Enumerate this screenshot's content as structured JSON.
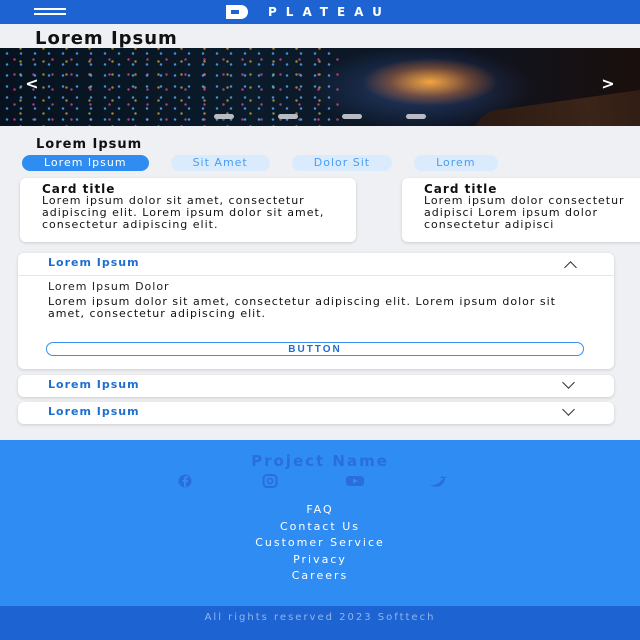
{
  "header": {
    "brand": "PLATEAU",
    "menu_icon": "hamburger-icon",
    "logo_icon": "plateau-logo-icon"
  },
  "page": {
    "title": "Lorem Ipsum"
  },
  "carousel": {
    "prev_label": "<",
    "next_label": ">",
    "slide_count": 4,
    "active_slide": 1
  },
  "section": {
    "title": "Lorem Ipsum"
  },
  "chips": [
    {
      "label": "Lorem Ipsum",
      "active": true
    },
    {
      "label": "Sit Amet",
      "active": false
    },
    {
      "label": "Dolor Sit",
      "active": false
    },
    {
      "label": "Lorem",
      "active": false
    }
  ],
  "cards": [
    {
      "title": "Card title",
      "text": "Lorem ipsum dolor sit amet, consectetur adipiscing elit. Lorem ipsum dolor sit amet, consectetur adipiscing elit."
    },
    {
      "title": "Card title",
      "text": "Lorem ipsum dolor consectetur adipisci Lorem ipsum dolor consectetur adipisci"
    }
  ],
  "accordion": [
    {
      "label": "Lorem Ipsum",
      "expanded": true,
      "subtitle": "Lorem Ipsum Dolor",
      "body": "Lorem ipsum dolor sit amet, consectetur adipiscing elit. Lorem ipsum dolor sit amet, consectetur adipiscing elit.",
      "button": "BUTTON"
    },
    {
      "label": "Lorem Ipsum",
      "expanded": false
    },
    {
      "label": "Lorem Ipsum",
      "expanded": false
    }
  ],
  "footer": {
    "project_name": "Project Name",
    "social_icons": [
      "facebook-icon",
      "instagram-icon",
      "youtube-icon",
      "twitter-icon"
    ],
    "links": [
      "FAQ",
      "Contact Us",
      "Customer Service",
      "Privacy",
      "Careers"
    ],
    "copyright": "All rights reserved 2023 Softtech"
  },
  "colors": {
    "primary": "#1e63d2",
    "accent": "#2f8cf0",
    "chip_bg": "#d9ebfd",
    "footer_bg": "#2f8cf3"
  }
}
